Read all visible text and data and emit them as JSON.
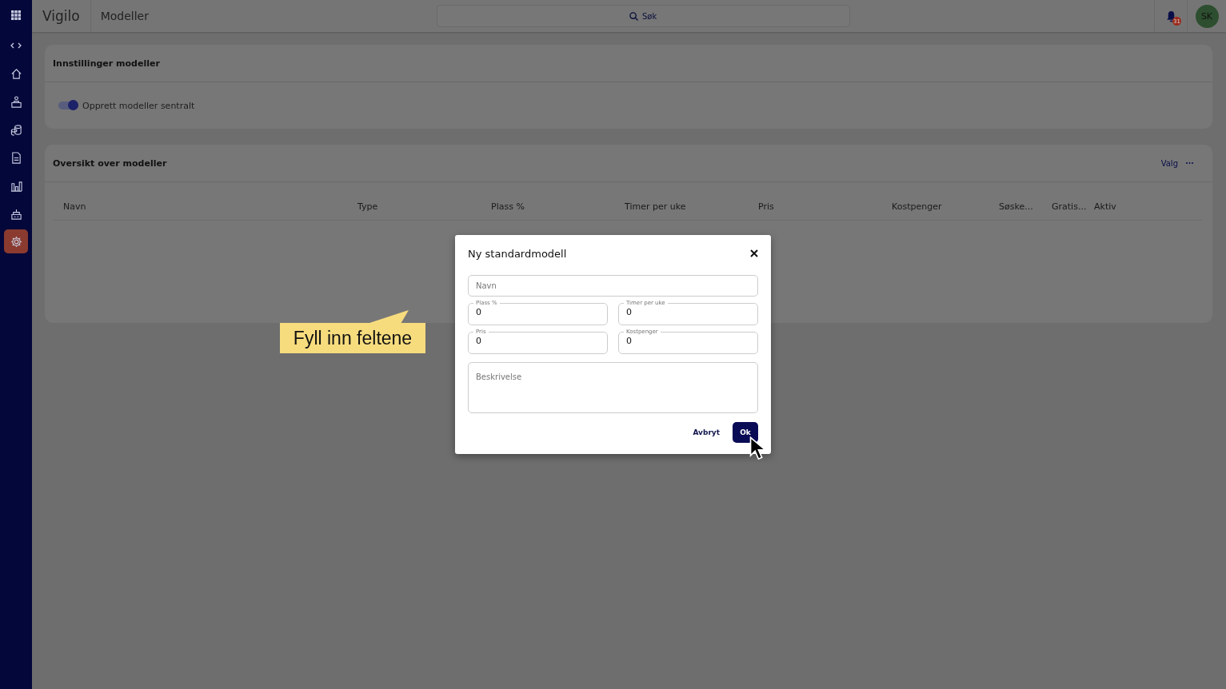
{
  "app": {
    "name": "Vigilo",
    "page_title": "Modeller"
  },
  "search": {
    "placeholder": "Søk"
  },
  "notifications": {
    "count": "31"
  },
  "user": {
    "initials": "SK"
  },
  "sidebar": {
    "items": [
      {
        "selected": false
      },
      {
        "selected": false
      },
      {
        "selected": false
      },
      {
        "selected": false
      },
      {
        "selected": false
      },
      {
        "selected": false
      },
      {
        "selected": true
      }
    ]
  },
  "settings_card": {
    "title": "Innstillinger modeller",
    "toggle": {
      "label": "Opprett modeller sentralt",
      "on": true
    }
  },
  "overview_card": {
    "title": "Oversikt over modeller",
    "menu_label": "Valg",
    "columns": [
      "Navn",
      "Type",
      "Plass %",
      "Timer per uke",
      "Pris",
      "Kostpenger",
      "Søske...",
      "Gratis...",
      "Aktiv"
    ]
  },
  "dialog": {
    "title": "Ny standardmodell",
    "name_field": {
      "placeholder": "Navn"
    },
    "number_fields": [
      {
        "label": "Plass %",
        "value": "0"
      },
      {
        "label": "Timer per uke",
        "value": "0"
      },
      {
        "label": "Pris",
        "value": "0"
      },
      {
        "label": "Kostpenger",
        "value": "0"
      }
    ],
    "description_field": {
      "placeholder": "Beskrivelse"
    },
    "cancel_button": "Avbryt",
    "ok_button": "Ok"
  },
  "callout": {
    "text": "Fyll inn feltene"
  }
}
